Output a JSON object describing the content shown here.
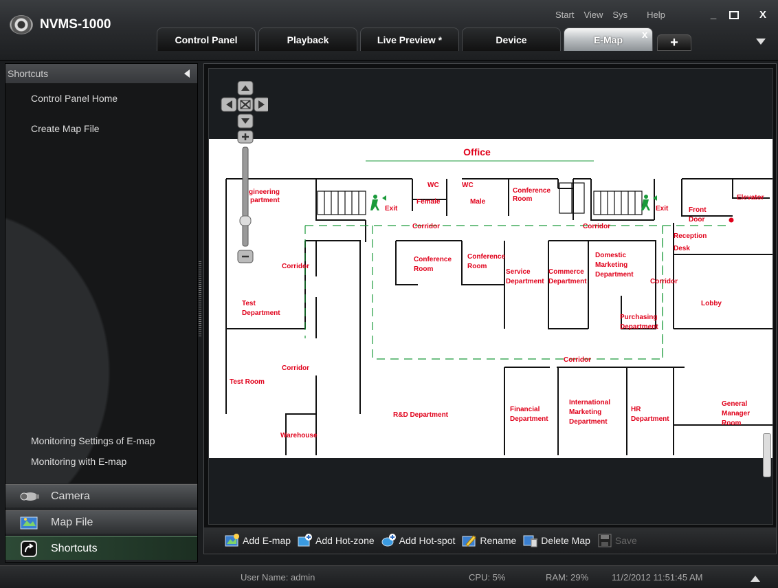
{
  "app": {
    "title": "NVMS-1000"
  },
  "sysmenu": {
    "start": "Start",
    "view": "View",
    "sys": "Sys",
    "help": "Help"
  },
  "window_buttons": {
    "minimize": "_",
    "maximize": "▫",
    "close": "X"
  },
  "tabs": [
    {
      "label": "Control Panel"
    },
    {
      "label": "Playback"
    },
    {
      "label": "Live Preview *"
    },
    {
      "label": "Device"
    },
    {
      "label": "E-Map",
      "active": true
    }
  ],
  "tab_close": "x",
  "tab_add": "+",
  "sidebar": {
    "header": "Shortcuts",
    "items_top": [
      "Control Panel Home",
      "Create Map File"
    ],
    "items_bottom": [
      "Monitoring Settings of E-map",
      "Monitoring with E-map"
    ],
    "accordion": [
      {
        "label": "Camera",
        "icon": "camera-icon"
      },
      {
        "label": "Map File",
        "icon": "map-file-icon"
      },
      {
        "label": "Shortcuts",
        "icon": "shortcuts-icon",
        "active": true
      }
    ]
  },
  "map": {
    "title": "Office",
    "rooms": [
      "gineering",
      "partment",
      "WC",
      "WC",
      "Female",
      "Male",
      "Conference",
      "Room",
      "Elevator",
      "Front",
      "Door",
      "Exit",
      "Exit",
      "Corridor",
      "Corridor",
      "Reception",
      "Desk",
      "Corridor",
      "Conference",
      "Room",
      "Conference",
      "Room",
      "Service",
      "Department",
      "Commerce",
      "Department",
      "Domestic",
      "Marketing",
      "Department",
      "Corridor",
      "Test",
      "Department",
      "Lobby",
      "Purchasing",
      "Department",
      "Corridor",
      "Corridor",
      "Test Room",
      "R&D Department",
      "Financial",
      "Department",
      "International",
      "Marketing",
      "Department",
      "HR",
      "Department",
      "General",
      "Manager",
      "Room",
      "Warehouse"
    ]
  },
  "toolbar": {
    "add_emap": "Add E-map",
    "add_hotzone": "Add Hot-zone",
    "add_hotspot": "Add Hot-spot",
    "rename": "Rename",
    "delete_map": "Delete Map",
    "save": "Save"
  },
  "status": {
    "user": "User Name: admin",
    "cpu": "CPU: 5%",
    "ram": "RAM: 29%",
    "datetime": "11/2/2012 11:51:45 AM"
  },
  "colors": {
    "room_label": "#e0001a",
    "corridor_line": "#1a9a3a",
    "active_tab": "#b9bdc0"
  }
}
